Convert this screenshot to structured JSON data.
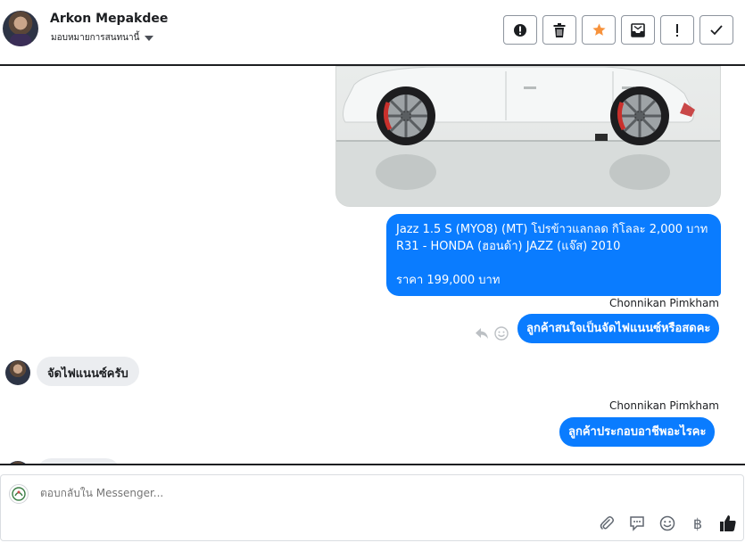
{
  "header": {
    "contact_name": "Arkon Mepakdee",
    "assign_label": "มอบหมายการสนทนานี้",
    "toolbar": [
      {
        "name": "spam-alert-button",
        "icon": "alert-circle-icon"
      },
      {
        "name": "delete-button",
        "icon": "trash-icon"
      },
      {
        "name": "star-button",
        "icon": "star-icon",
        "color": "#f7923b"
      },
      {
        "name": "archive-button",
        "icon": "archive-icon"
      },
      {
        "name": "follow-up-button",
        "icon": "exclamation-icon"
      },
      {
        "name": "mark-done-button",
        "icon": "checkmark-icon"
      }
    ]
  },
  "messages": {
    "listing": {
      "line1": "Jazz 1.5 S (MYO8) (MT) โปรข้าวแลกลด กิโลละ 2,000 บาท",
      "line2": "R31 - HONDA (ฮอนด้า) JAZZ (แจ๊ส) 2010",
      "price": "ราคา 199,000 บาท"
    },
    "sender1": "Chonnikan Pimkham",
    "out1": "ลูกค้าสนใจเป็นจัดไฟแนนซ์หรือสดคะ",
    "in1": "จัดไฟแนนซ์ครับ",
    "sender2": "Chonnikan Pimkham",
    "out2": "ลูกค้าประกอบอาชีพอะไรคะ"
  },
  "composer": {
    "placeholder": "ตอบกลับใน Messenger...",
    "tools": [
      "attach-icon",
      "saved-reply-icon",
      "emoji-icon",
      "baht-icon",
      "like-icon"
    ]
  },
  "colors": {
    "accent": "#0a7cff",
    "incoming_bubble": "#ebedf0",
    "star": "#f7923b"
  }
}
